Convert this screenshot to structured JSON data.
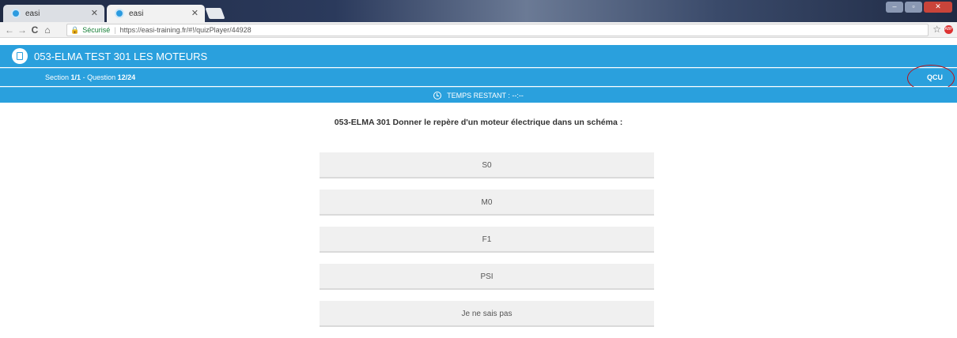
{
  "browser": {
    "tabs": [
      {
        "title": "easi",
        "active": false
      },
      {
        "title": "easi",
        "active": true
      }
    ],
    "url_secure_label": "Sécurisé",
    "url": "https://easi-training.fr/#!/quizPlayer/44928",
    "nav": {
      "back": "←",
      "forward": "→",
      "reload": "C",
      "home": "⌂"
    },
    "bookmark_star": "☆",
    "extension_badge": "ABP"
  },
  "header": {
    "title": "053-ELMA TEST 301 LES MOTEURS",
    "section_prefix": "Section ",
    "section_value": "1/1",
    "question_prefix": " - Question ",
    "question_value": "12/24",
    "question_type": "QCU",
    "timer_label": "TEMPS RESTANT : --:--"
  },
  "quiz": {
    "question": "053-ELMA 301 Donner le repère d'un moteur électrique dans un schéma :",
    "answers": [
      "S0",
      "M0",
      "F1",
      "PSI",
      "Je ne sais pas"
    ]
  },
  "colors": {
    "brand": "#2aa0dd",
    "highlight_circle": "#b5121b"
  }
}
